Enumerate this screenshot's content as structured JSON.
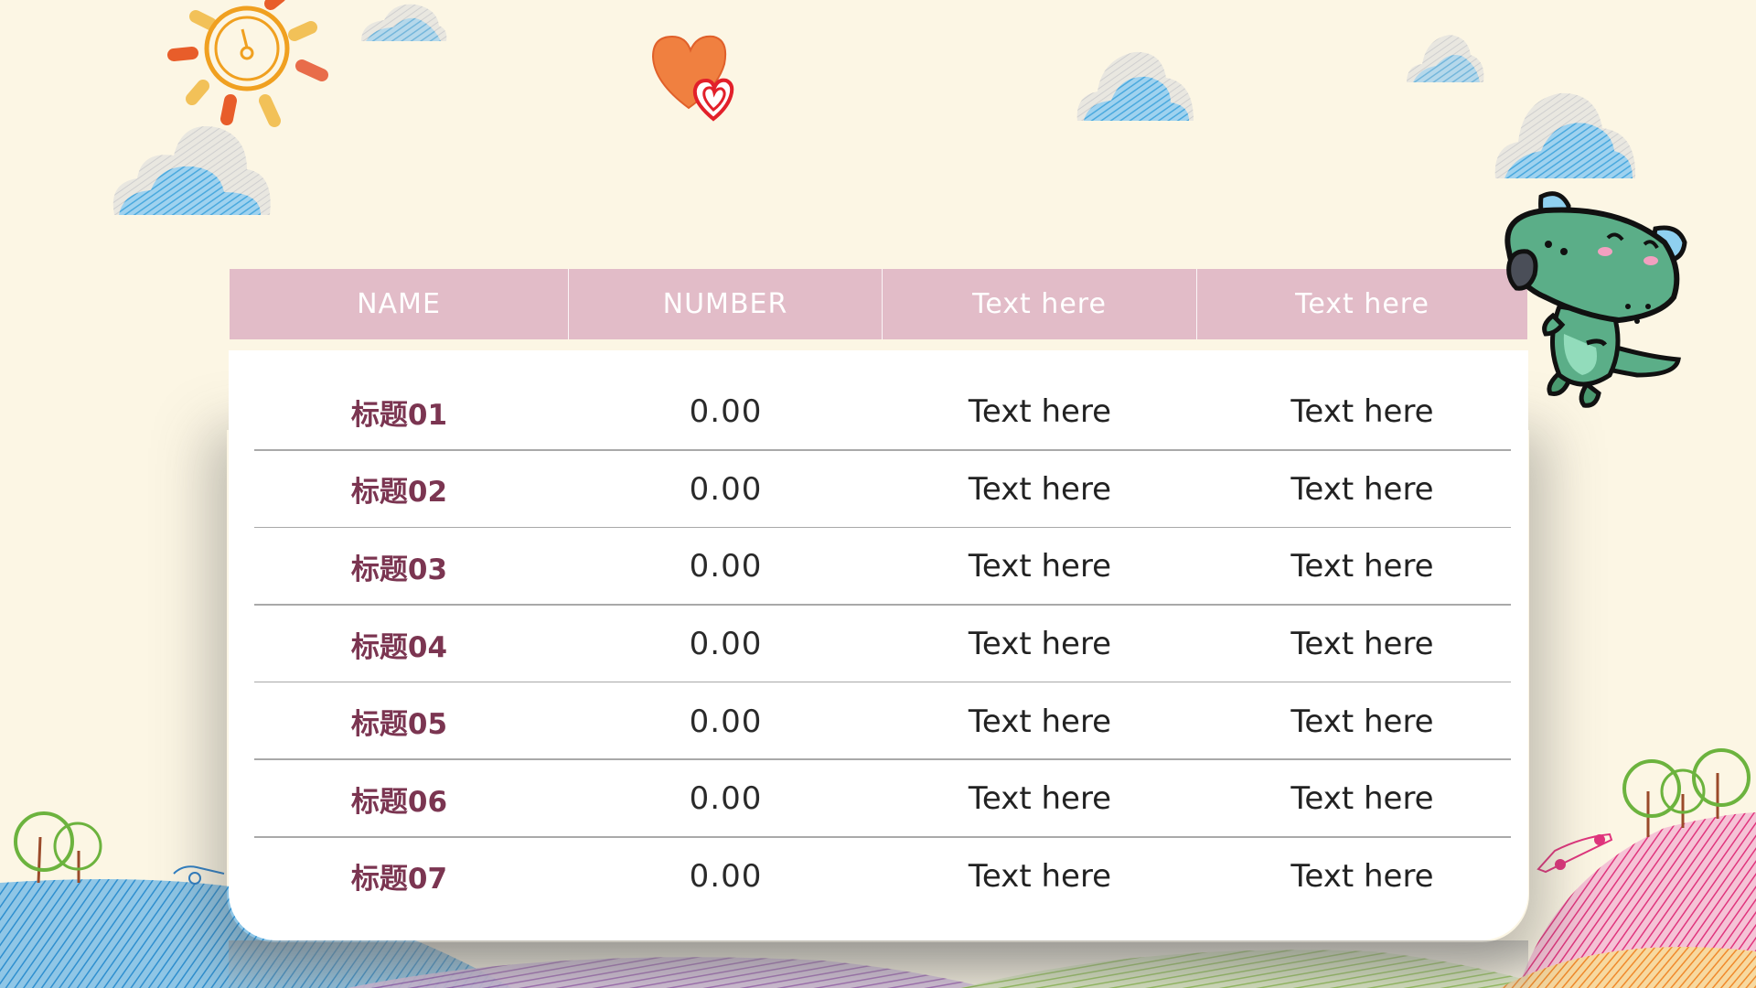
{
  "table": {
    "headers": [
      "NAME",
      "NUMBER",
      "Text here",
      "Text here"
    ],
    "rows": [
      {
        "name": "标题01",
        "number": "0.00",
        "col3": "Text here",
        "col4": "Text here"
      },
      {
        "name": "标题02",
        "number": "0.00",
        "col3": "Text here",
        "col4": "Text here"
      },
      {
        "name": "标题03",
        "number": "0.00",
        "col3": "Text here",
        "col4": "Text here"
      },
      {
        "name": "标题04",
        "number": "0.00",
        "col3": "Text here",
        "col4": "Text here"
      },
      {
        "name": "标题05",
        "number": "0.00",
        "col3": "Text here",
        "col4": "Text here"
      },
      {
        "name": "标题06",
        "number": "0.00",
        "col3": "Text here",
        "col4": "Text here"
      },
      {
        "name": "标题07",
        "number": "0.00",
        "col3": "Text here",
        "col4": "Text here"
      }
    ]
  },
  "colors": {
    "background": "#fcf6e4",
    "header": "#e2bcc8",
    "name_text": "#7b3551",
    "card": "#ffffff"
  },
  "decorations": [
    "sun-icon",
    "cloud-icon",
    "heart-icon",
    "dinosaur-mascot",
    "tree-icon",
    "car-icon",
    "hill"
  ]
}
